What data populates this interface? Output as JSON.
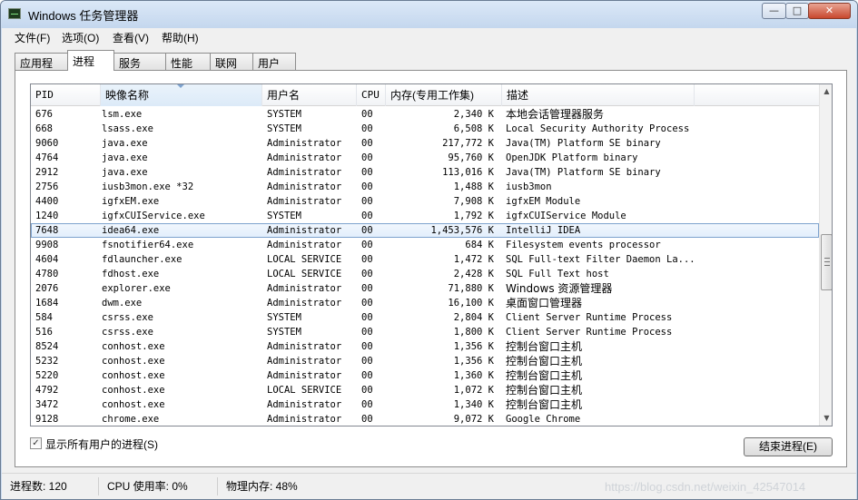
{
  "window": {
    "title": "Windows 任务管理器",
    "min_glyph": "—",
    "max_glyph": "□",
    "close_glyph": "✕"
  },
  "menu": [
    {
      "label": "文件(F)"
    },
    {
      "label": "选项(O)"
    },
    {
      "label": "查看(V)"
    },
    {
      "label": "帮助(H)"
    }
  ],
  "tabs": [
    {
      "label": "应用程序",
      "active": false
    },
    {
      "label": "进程",
      "active": true
    },
    {
      "label": "服务",
      "active": false
    },
    {
      "label": "性能",
      "active": false
    },
    {
      "label": "联网",
      "active": false
    },
    {
      "label": "用户",
      "active": false
    }
  ],
  "columns": {
    "pid": "PID",
    "name": "映像名称",
    "user": "用户名",
    "cpu": "CPU",
    "mem": "内存(专用工作集)",
    "desc": "描述"
  },
  "processes": [
    {
      "pid": "676",
      "name": "lsm.exe",
      "user": "SYSTEM",
      "cpu": "00",
      "mem": "2,340 K",
      "desc": "本地会话管理器服务"
    },
    {
      "pid": "668",
      "name": "lsass.exe",
      "user": "SYSTEM",
      "cpu": "00",
      "mem": "6,508 K",
      "desc": "Local Security Authority Process"
    },
    {
      "pid": "9060",
      "name": "java.exe",
      "user": "Administrator",
      "cpu": "00",
      "mem": "217,772 K",
      "desc": "Java(TM) Platform SE binary"
    },
    {
      "pid": "4764",
      "name": "java.exe",
      "user": "Administrator",
      "cpu": "00",
      "mem": "95,760 K",
      "desc": "OpenJDK Platform binary"
    },
    {
      "pid": "2912",
      "name": "java.exe",
      "user": "Administrator",
      "cpu": "00",
      "mem": "113,016 K",
      "desc": "Java(TM) Platform SE binary"
    },
    {
      "pid": "2756",
      "name": "iusb3mon.exe *32",
      "user": "Administrator",
      "cpu": "00",
      "mem": "1,488 K",
      "desc": "iusb3mon"
    },
    {
      "pid": "4400",
      "name": "igfxEM.exe",
      "user": "Administrator",
      "cpu": "00",
      "mem": "7,908 K",
      "desc": "igfxEM Module"
    },
    {
      "pid": "1240",
      "name": "igfxCUIService.exe",
      "user": "SYSTEM",
      "cpu": "00",
      "mem": "1,792 K",
      "desc": "igfxCUIService Module"
    },
    {
      "pid": "7648",
      "name": "idea64.exe",
      "user": "Administrator",
      "cpu": "00",
      "mem": "1,453,576 K",
      "desc": "IntelliJ IDEA",
      "selected": true
    },
    {
      "pid": "9908",
      "name": "fsnotifier64.exe",
      "user": "Administrator",
      "cpu": "00",
      "mem": "684 K",
      "desc": "Filesystem events processor"
    },
    {
      "pid": "4604",
      "name": "fdlauncher.exe",
      "user": "LOCAL SERVICE",
      "cpu": "00",
      "mem": "1,472 K",
      "desc": "SQL Full-text Filter Daemon La..."
    },
    {
      "pid": "4780",
      "name": "fdhost.exe",
      "user": "LOCAL SERVICE",
      "cpu": "00",
      "mem": "2,428 K",
      "desc": "SQL Full Text host"
    },
    {
      "pid": "2076",
      "name": "explorer.exe",
      "user": "Administrator",
      "cpu": "00",
      "mem": "71,880 K",
      "desc": "Windows 资源管理器"
    },
    {
      "pid": "1684",
      "name": "dwm.exe",
      "user": "Administrator",
      "cpu": "00",
      "mem": "16,100 K",
      "desc": "桌面窗口管理器"
    },
    {
      "pid": "584",
      "name": "csrss.exe",
      "user": "SYSTEM",
      "cpu": "00",
      "mem": "2,804 K",
      "desc": "Client Server Runtime Process"
    },
    {
      "pid": "516",
      "name": "csrss.exe",
      "user": "SYSTEM",
      "cpu": "00",
      "mem": "1,800 K",
      "desc": "Client Server Runtime Process"
    },
    {
      "pid": "8524",
      "name": "conhost.exe",
      "user": "Administrator",
      "cpu": "00",
      "mem": "1,356 K",
      "desc": "控制台窗口主机"
    },
    {
      "pid": "5232",
      "name": "conhost.exe",
      "user": "Administrator",
      "cpu": "00",
      "mem": "1,356 K",
      "desc": "控制台窗口主机"
    },
    {
      "pid": "5220",
      "name": "conhost.exe",
      "user": "Administrator",
      "cpu": "00",
      "mem": "1,360 K",
      "desc": "控制台窗口主机"
    },
    {
      "pid": "4792",
      "name": "conhost.exe",
      "user": "LOCAL SERVICE",
      "cpu": "00",
      "mem": "1,072 K",
      "desc": "控制台窗口主机"
    },
    {
      "pid": "3472",
      "name": "conhost.exe",
      "user": "Administrator",
      "cpu": "00",
      "mem": "1,340 K",
      "desc": "控制台窗口主机"
    },
    {
      "pid": "9128",
      "name": "chrome.exe",
      "user": "Administrator",
      "cpu": "00",
      "mem": "9,072 K",
      "desc": "Google Chrome"
    }
  ],
  "show_all_users": {
    "label": "显示所有用户的进程(S)",
    "checked": true
  },
  "end_process_label": "结束进程(E)",
  "status": {
    "processes": "进程数: 120",
    "cpu": "CPU 使用率: 0%",
    "memory": "物理内存: 48%"
  },
  "watermark": "https://blog.csdn.net/weixin_42547014",
  "icons": {
    "scroll_up": "▲",
    "scroll_down": "▼",
    "check": "✓"
  }
}
